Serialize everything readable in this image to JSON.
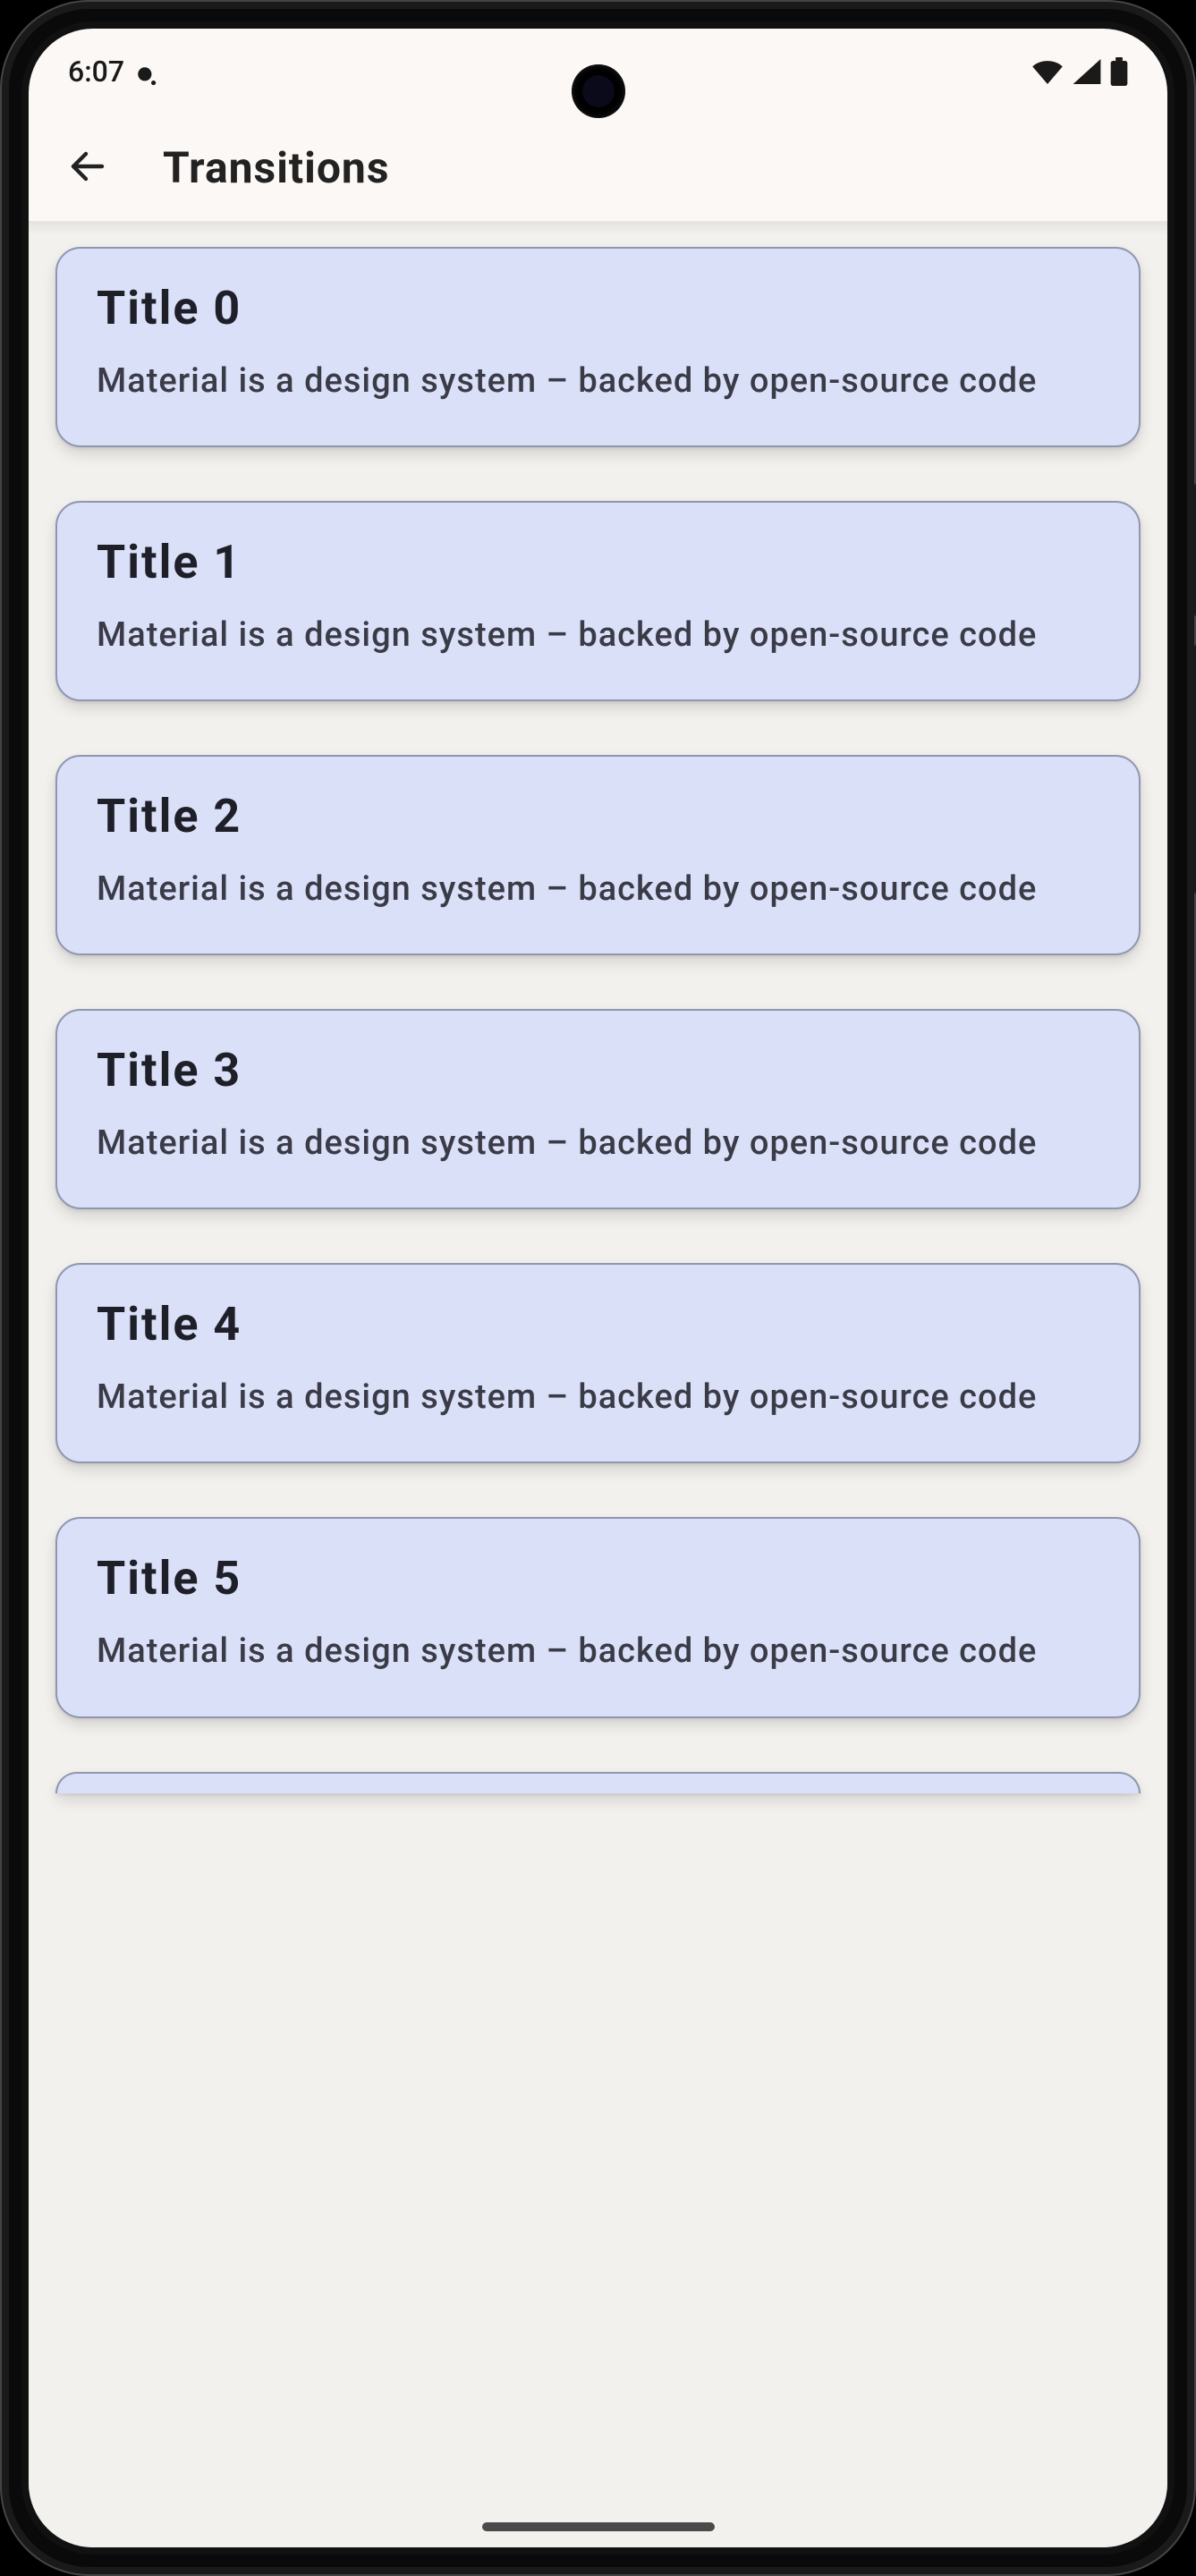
{
  "status_bar": {
    "time": "6:07"
  },
  "app_bar": {
    "title": "Transitions"
  },
  "cards": [
    {
      "title": "Title 0",
      "subtitle": "Material is a design system – backed by open-source code"
    },
    {
      "title": "Title 1",
      "subtitle": "Material is a design system – backed by open-source code"
    },
    {
      "title": "Title 2",
      "subtitle": "Material is a design system – backed by open-source code"
    },
    {
      "title": "Title 3",
      "subtitle": "Material is a design system – backed by open-source code"
    },
    {
      "title": "Title 4",
      "subtitle": "Material is a design system – backed by open-source code"
    },
    {
      "title": "Title 5",
      "subtitle": "Material is a design system – backed by open-source code"
    }
  ]
}
